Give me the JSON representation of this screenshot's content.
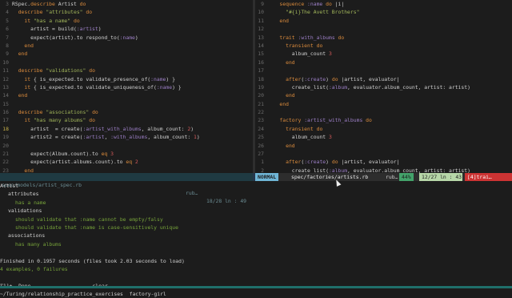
{
  "left_editor": {
    "lines": [
      {
        "n": "3",
        "t": "RSpec.describe Artist do"
      },
      {
        "n": "4",
        "t": "  describe \"attributes\" do"
      },
      {
        "n": "5",
        "t": "    it \"has a name\" do"
      },
      {
        "n": "6",
        "t": "      artist = build(:artist)"
      },
      {
        "n": "7",
        "t": "      expect(artist).to respond_to(:name)"
      },
      {
        "n": "8",
        "t": "    end"
      },
      {
        "n": "9",
        "t": "  end"
      },
      {
        "n": "10",
        "t": ""
      },
      {
        "n": "11",
        "t": "  describe \"validations\" do"
      },
      {
        "n": "12",
        "t": "    it { is_expected.to validate_presence_of(:name) }"
      },
      {
        "n": "13",
        "t": "    it { is_expected.to validate_uniqueness_of(:name) }"
      },
      {
        "n": "14",
        "t": "  end"
      },
      {
        "n": "15",
        "t": ""
      },
      {
        "n": "16",
        "t": "  describe \"associations\" do"
      },
      {
        "n": "17",
        "t": "    it \"has many albums\" do"
      },
      {
        "n": "18",
        "t": "      artist  = create(:artist_with_albums, album_count: 2)"
      },
      {
        "n": "19",
        "t": "      artist2 = create(:artist, :with_albums, album_count: 1)"
      },
      {
        "n": "20",
        "t": ""
      },
      {
        "n": "21",
        "t": "      expect(Album.count).to eq 3"
      },
      {
        "n": "22",
        "t": "      expect(artist.albums.count).to eq 2"
      },
      {
        "n": "23",
        "t": "    end"
      },
      {
        "n": "24",
        "t": "  end"
      },
      {
        "n": "25",
        "t": "end"
      }
    ]
  },
  "right_editor": {
    "lines": [
      {
        "n": "9",
        "t": "    sequence :name do |i|"
      },
      {
        "n": "10",
        "t": "      \"#{i}The Avett Brothers\""
      },
      {
        "n": "11",
        "t": "    end"
      },
      {
        "n": "12",
        "t": ""
      },
      {
        "n": "13",
        "t": "    trait :with_albums do"
      },
      {
        "n": "14",
        "t": "      transient do"
      },
      {
        "n": "15",
        "t": "        album_count 3"
      },
      {
        "n": "16",
        "t": "      end"
      },
      {
        "n": "17",
        "t": ""
      },
      {
        "n": "18",
        "t": "      after(:create) do |artist, evaluator|"
      },
      {
        "n": "19",
        "t": "        create_list(:album, evaluator.album_count, artist: artist)"
      },
      {
        "n": "20",
        "t": "      end"
      },
      {
        "n": "21",
        "t": "    end"
      },
      {
        "n": "22",
        "t": ""
      },
      {
        "n": "23",
        "t": "    factory :artist_with_albums do"
      },
      {
        "n": "24",
        "t": "      transient do"
      },
      {
        "n": "25",
        "t": "        album_count 3"
      },
      {
        "n": "26",
        "t": "      end"
      },
      {
        "n": "27",
        "t": ""
      },
      {
        "n": "1",
        "t": "      after(:create) do |artist, evaluator|"
      },
      {
        "n": "2",
        "t": "        create_list(:album, evaluator.album_count, artist: artist)"
      },
      {
        "n": "3",
        "t": "      end"
      },
      {
        "n": "4",
        "t": "    end"
      },
      {
        "n": "5",
        "t": "  end"
      },
      {
        "n": "6",
        "t": "end"
      }
    ]
  },
  "status": {
    "left_file": "spec/models/artist_spec.rb",
    "left_ft": "rub…",
    "left_pos": "18/28 ln : 49",
    "mode": "NORMAL",
    "right_file": "spec/factories/artists.rb",
    "right_ft": "rub…",
    "right_pct": "44%",
    "right_pos": "12/27 ln : 43",
    "right_warn": "[4]trai…"
  },
  "terminal": {
    "lines": [
      {
        "t": "Artist",
        "cls": "",
        "indent": 0
      },
      {
        "t": "attributes",
        "cls": "",
        "indent": 1
      },
      {
        "t": "has a name",
        "cls": "t-green",
        "indent": 2
      },
      {
        "t": "validations",
        "cls": "",
        "indent": 1
      },
      {
        "t": "should validate that :name cannot be empty/falsy",
        "cls": "t-green",
        "indent": 2
      },
      {
        "t": "should validate that :name is case-sensitively unique",
        "cls": "t-green",
        "indent": 2
      },
      {
        "t": "associations",
        "cls": "",
        "indent": 1
      },
      {
        "t": "has many albums",
        "cls": "t-green",
        "indent": 2
      },
      {
        "t": "",
        "cls": "",
        "indent": 0
      },
      {
        "t": "Finished in 0.1957 seconds (files took 2.03 seconds to load)",
        "cls": "",
        "indent": 0
      },
      {
        "t": "4 examples, 0 failures",
        "cls": "t-green",
        "indent": 0
      },
      {
        "t": "",
        "cls": "",
        "indent": 0
      },
      {
        "t": "[1]+  Done                    clear",
        "cls": "",
        "indent": 0
      },
      {
        "t": "~/Turing/relationship_practice_exercises  factory-girl",
        "cls": "",
        "indent": 0
      }
    ],
    "prompt": "∞"
  }
}
